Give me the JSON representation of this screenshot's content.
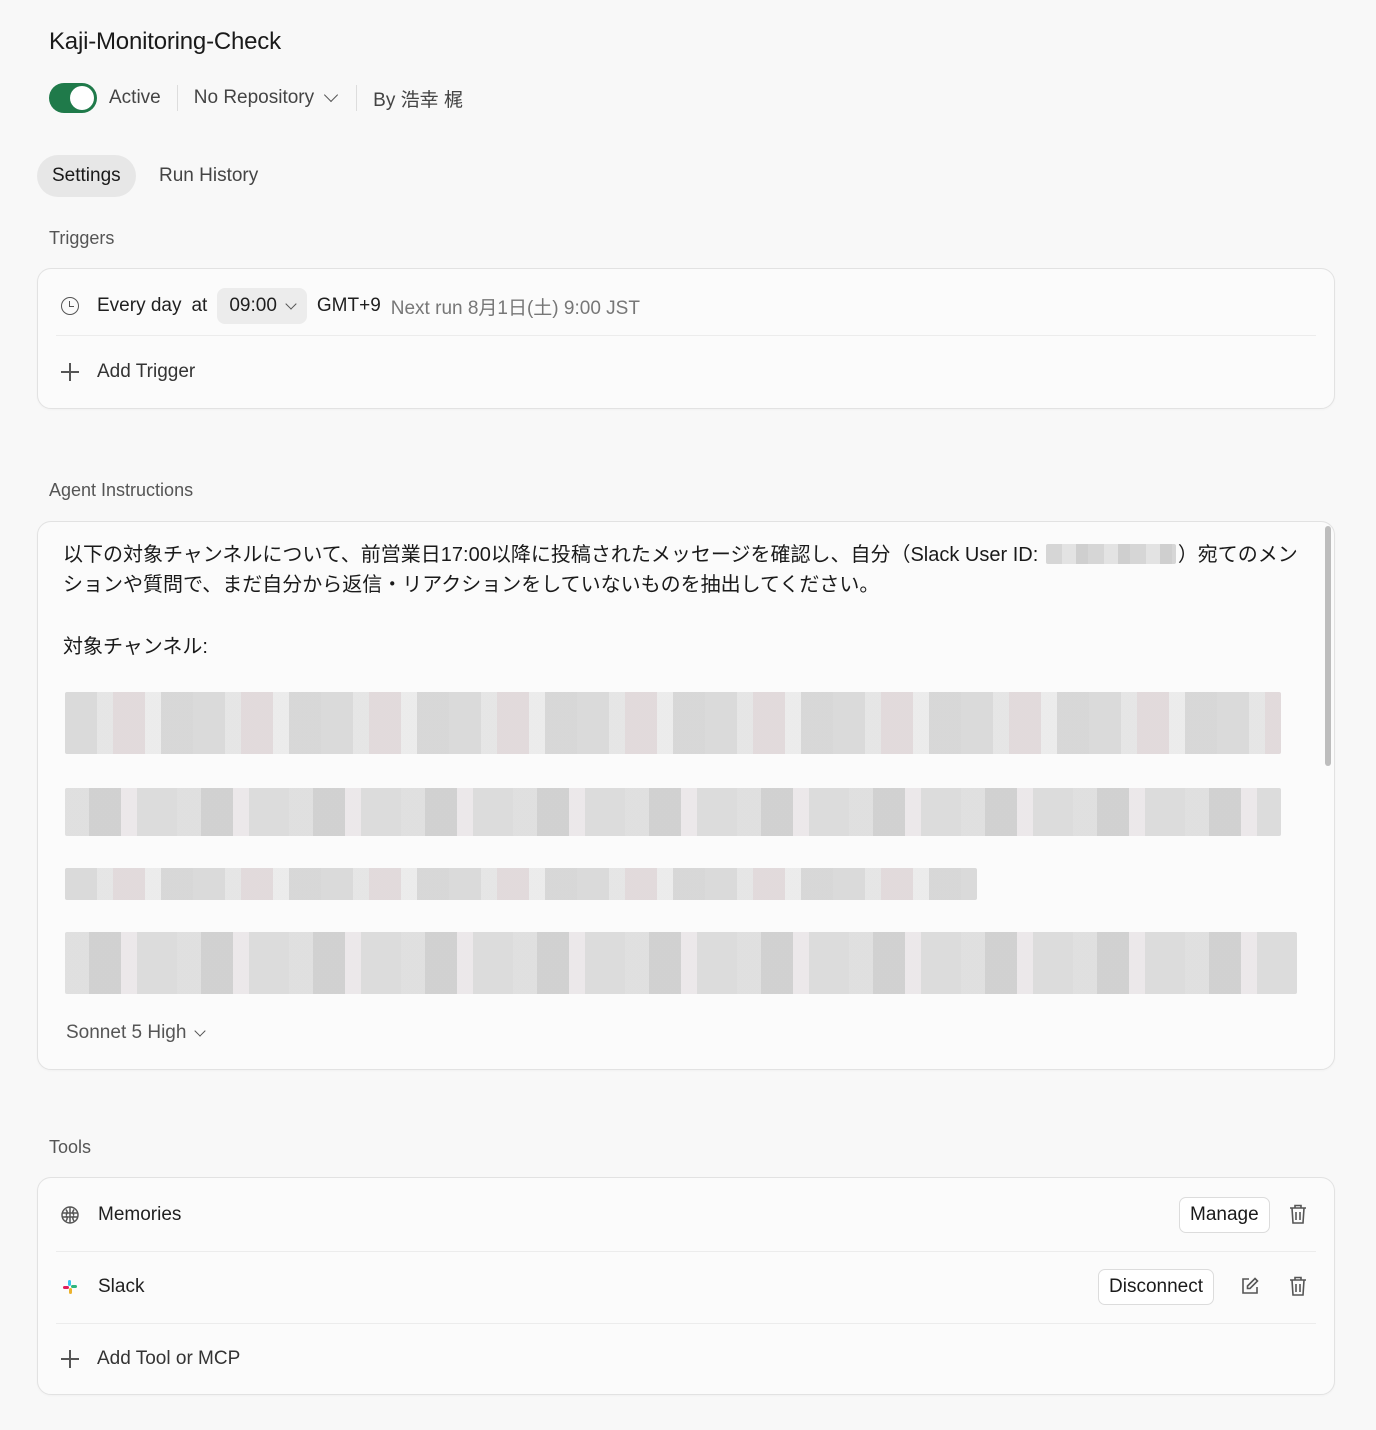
{
  "header": {
    "title": "Kaji-Monitoring-Check",
    "status": "Active",
    "repository": "No Repository",
    "author": "By 浩幸 梶"
  },
  "tabs": [
    {
      "label": "Settings",
      "active": true
    },
    {
      "label": "Run History",
      "active": false
    }
  ],
  "triggers": {
    "section_label": "Triggers",
    "schedule": {
      "frequency": "Every day",
      "at": "at",
      "time": "09:00",
      "timezone": "GMT+9",
      "next_run": "Next run 8月1日(土) 9:00 JST"
    },
    "add_label": "Add Trigger"
  },
  "instructions": {
    "section_label": "Agent Instructions",
    "text_part1": "以下の対象チャンネルについて、前営業日17:00以降に投稿されたメッセージを確認し、自分（Slack User ID: ",
    "text_part2": "）宛てのメンションや質問で、まだ自分から返信・リアクションをしていないものを抽出してください。",
    "channels_label": "対象チャンネル:",
    "model": "Sonnet 5 High"
  },
  "tools": {
    "section_label": "Tools",
    "items": [
      {
        "name": "Memories",
        "action": "Manage"
      },
      {
        "name": "Slack",
        "action": "Disconnect"
      }
    ],
    "add_label": "Add Tool or MCP"
  },
  "colors": {
    "toggle_on": "#1f7a4a",
    "background": "#f8f8f8",
    "card_border": "#e2e2e2"
  }
}
